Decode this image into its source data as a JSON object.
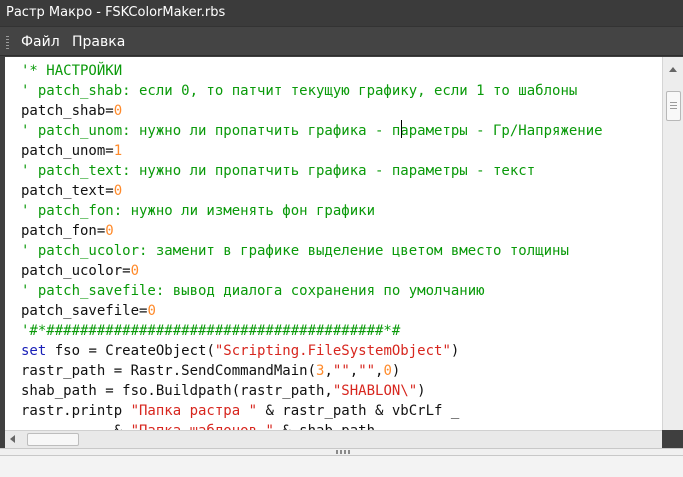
{
  "window": {
    "title": "Растр Макро - FSKColorMaker.rbs"
  },
  "menu": {
    "items": [
      {
        "label": "Файл"
      },
      {
        "label": "Правка"
      }
    ]
  },
  "colors": {
    "comment": "#0a9a0a",
    "keyword": "#1a20b8",
    "string": "#d7261e",
    "number": "#ff8a2a"
  },
  "editor": {
    "lines": [
      [
        {
          "t": "'* НАСТРОЙКИ",
          "k": "comment"
        }
      ],
      [
        {
          "t": "' patch_shab: если 0, то патчит текущую графику, если 1 то шаблоны",
          "k": "comment"
        }
      ],
      [
        {
          "t": "patch_shab=",
          "k": "plain"
        },
        {
          "t": "0",
          "k": "number"
        }
      ],
      [
        {
          "t": "' patch_unom: нужно ли пропатчить графика - параметры - Гр/Напряжение",
          "k": "comment"
        }
      ],
      [
        {
          "t": "patch_unom=",
          "k": "plain"
        },
        {
          "t": "1",
          "k": "number"
        }
      ],
      [
        {
          "t": "' patch_text: нужно ли пропатчить графика - параметры - текст",
          "k": "comment"
        }
      ],
      [
        {
          "t": "patch_text=",
          "k": "plain"
        },
        {
          "t": "0",
          "k": "number"
        }
      ],
      [
        {
          "t": "' patch_fon: нужно ли изменять фон графики",
          "k": "comment"
        }
      ],
      [
        {
          "t": "patch_fon=",
          "k": "plain"
        },
        {
          "t": "0",
          "k": "number"
        }
      ],
      [
        {
          "t": "' patch_ucolor: заменит в графике выделение цветом вместо толщины",
          "k": "comment"
        }
      ],
      [
        {
          "t": "patch_ucolor=",
          "k": "plain"
        },
        {
          "t": "0",
          "k": "number"
        }
      ],
      [
        {
          "t": "' patch_savefile: вывод диалога сохранения по умолчанию",
          "k": "comment"
        }
      ],
      [
        {
          "t": "patch_savefile=",
          "k": "plain"
        },
        {
          "t": "0",
          "k": "number"
        }
      ],
      [
        {
          "t": "'#*########################################*#",
          "k": "comment"
        }
      ],
      [
        {
          "t": "set",
          "k": "keyword"
        },
        {
          "t": " fso = CreateObject(",
          "k": "plain"
        },
        {
          "t": "\"Scripting.FileSystemObject\"",
          "k": "string"
        },
        {
          "t": ")",
          "k": "plain"
        }
      ],
      [
        {
          "t": "rastr_path = Rastr.SendCommandMain(",
          "k": "plain"
        },
        {
          "t": "3",
          "k": "number"
        },
        {
          "t": ",",
          "k": "plain"
        },
        {
          "t": "\"\"",
          "k": "string"
        },
        {
          "t": ",",
          "k": "plain"
        },
        {
          "t": "\"\"",
          "k": "string"
        },
        {
          "t": ",",
          "k": "plain"
        },
        {
          "t": "0",
          "k": "number"
        },
        {
          "t": ")",
          "k": "plain"
        }
      ],
      [
        {
          "t": "shab_path = fso.Buildpath(rastr_path,",
          "k": "plain"
        },
        {
          "t": "\"SHABLON\\\"",
          "k": "string"
        },
        {
          "t": ")",
          "k": "plain"
        }
      ],
      [
        {
          "t": "rastr.printp ",
          "k": "plain"
        },
        {
          "t": "\"Папка растра \"",
          "k": "string"
        },
        {
          "t": " & rastr_path & vbCrLf _",
          "k": "plain"
        }
      ],
      [
        {
          "t": "           & ",
          "k": "plain"
        },
        {
          "t": "\"Папка шаблонов \"",
          "k": "string"
        },
        {
          "t": " & shab_path",
          "k": "plain"
        }
      ]
    ]
  }
}
